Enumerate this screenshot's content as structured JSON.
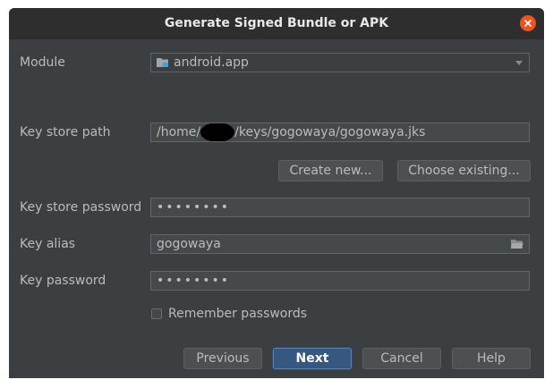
{
  "dialog": {
    "title": "Generate Signed Bundle or APK"
  },
  "form": {
    "module_label": "Module",
    "module_value": "android.app",
    "keystore_path_label": "Key store path",
    "keystore_path_prefix": "/home/",
    "keystore_path_suffix": "/keys/gogowaya/gogowaya.jks",
    "create_new_label": "Create new...",
    "choose_existing_label": "Choose existing...",
    "keystore_password_label": "Key store password",
    "keystore_password_value": "••••••••",
    "key_alias_label": "Key alias",
    "key_alias_value": "gogowaya",
    "key_password_label": "Key password",
    "key_password_value": "••••••••",
    "remember_label": "Remember passwords",
    "remember_checked": false
  },
  "buttons": {
    "previous": "Previous",
    "next": "Next",
    "cancel": "Cancel",
    "help": "Help"
  },
  "icons": {
    "close": "close-icon",
    "module": "module-folder-icon",
    "browse": "folder-icon",
    "dropdown": "chevron-down-icon"
  },
  "colors": {
    "background": "#3c3f41",
    "titlebar": "#2e2e2e",
    "close": "#e9541f",
    "default_button": "#365880"
  }
}
